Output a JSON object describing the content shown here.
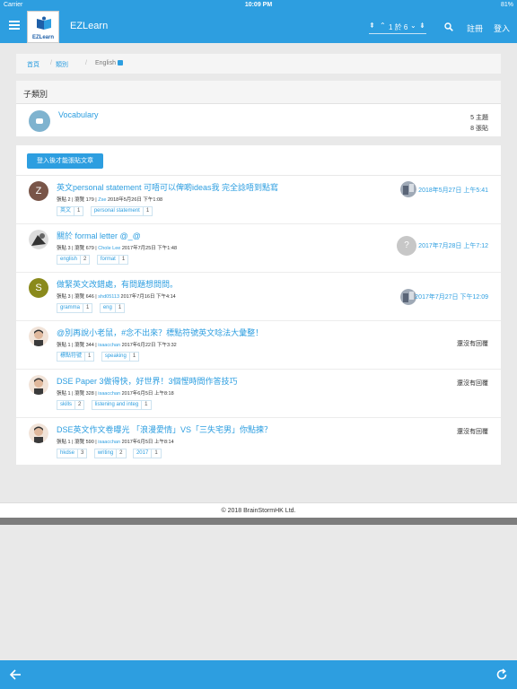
{
  "statusbar": {
    "carrier": "Carrier",
    "time": "10:09 PM",
    "battery": "81%"
  },
  "navbar": {
    "brand": "EZLearn",
    "logo_text": "EZLearn",
    "pager_text": "1 於 6",
    "register": "註冊",
    "login": "登入"
  },
  "breadcrumb": {
    "home": "首頁",
    "separator": "/",
    "category": "類別",
    "current": "English"
  },
  "subcategories": {
    "heading": "子類別",
    "items": [
      {
        "name": "Vocabulary",
        "topics": "5 主題",
        "posts": "8 張貼"
      }
    ]
  },
  "topics_panel": {
    "new_topic_label": "登入後才能張貼文章",
    "topics": [
      {
        "avatar_letter": "Z",
        "avatar_color": "#795548",
        "title": "英文personal statement 可唔可以俾啲ideas我 完全諗唔到點寫",
        "meta_prefix": "張貼 2 | 瀏覽 179 | ",
        "author": "Zse",
        "meta_date": " 2018年5月26日 下午1:08",
        "tags": [
          {
            "name": "英文",
            "count": "1"
          },
          {
            "name": "personal statement",
            "count": "1"
          }
        ],
        "last_post": "2018年5月27日 上午5:41"
      },
      {
        "avatar_letter": "",
        "avatar_color": "#555555",
        "title": "關於 formal letter @_@",
        "meta_prefix": "張貼 3 | 瀏覽 679 | ",
        "author": "Chole Lee",
        "meta_date": " 2017年7月25日 下午1:48",
        "tags": [
          {
            "name": "english",
            "count": "2"
          },
          {
            "name": "format",
            "count": "1"
          }
        ],
        "last_post": "2017年7月28日 上午7:12"
      },
      {
        "avatar_letter": "S",
        "avatar_color": "#8a8a1c",
        "title": "做緊英文改錯處，有問題想問問。",
        "meta_prefix": "張貼 3 | 瀏覽 646 | ",
        "author": "shd05113",
        "meta_date": " 2017年7月16日 下午4:14",
        "tags": [
          {
            "name": "gramma",
            "count": "1"
          },
          {
            "name": "eng",
            "count": "1"
          }
        ],
        "last_post": "2017年7月27日 下午12:09"
      },
      {
        "avatar_letter": "",
        "avatar_color": "#e6c7b4",
        "title": "@別再說小老鼠，#念不出來？標點符號英文唸法大彙整！",
        "meta_prefix": "張貼 1 | 瀏覽 344 | ",
        "author": "isaacchan",
        "meta_date": " 2017年6月22日 下午3:32",
        "tags": [
          {
            "name": "標點符號",
            "count": "1"
          },
          {
            "name": "speaking",
            "count": "1"
          }
        ],
        "last_post": "還沒有回覆"
      },
      {
        "avatar_letter": "",
        "avatar_color": "#e6c7b4",
        "title": "DSE Paper 3做得快，好世界！3個慳時間作答技巧",
        "meta_prefix": "張貼 1 | 瀏覽 328 | ",
        "author": "isaacchan",
        "meta_date": " 2017年6月5日 上午8:18",
        "tags": [
          {
            "name": "skills",
            "count": "2"
          },
          {
            "name": "listening and integ",
            "count": "1"
          }
        ],
        "last_post": "還沒有回覆"
      },
      {
        "avatar_letter": "",
        "avatar_color": "#e6c7b4",
        "title": "DSE英文作文卷曝光 「浪漫愛情」VS「三失宅男」你點揀？",
        "meta_prefix": "張貼 1 | 瀏覽 590 | ",
        "author": "isaacchan",
        "meta_date": " 2017年6月5日 上午8:14",
        "tags": [
          {
            "name": "hkdse",
            "count": "3"
          },
          {
            "name": "writing",
            "count": "2"
          },
          {
            "name": "2017",
            "count": "1"
          }
        ],
        "last_post": "還沒有回覆"
      }
    ]
  },
  "footer": {
    "copyright": "© 2018 BrainStormHK Ltd."
  },
  "icons": {
    "menu": "menu-icon",
    "search": "search-icon",
    "rss": "rss-icon",
    "back": "arrow-left-icon",
    "refresh": "refresh-icon",
    "comment": "comment-icon",
    "pager_up": "chevron-up-icon",
    "pager_down": "chevron-down-icon"
  },
  "colors": {
    "primary": "#2d9ee0"
  }
}
